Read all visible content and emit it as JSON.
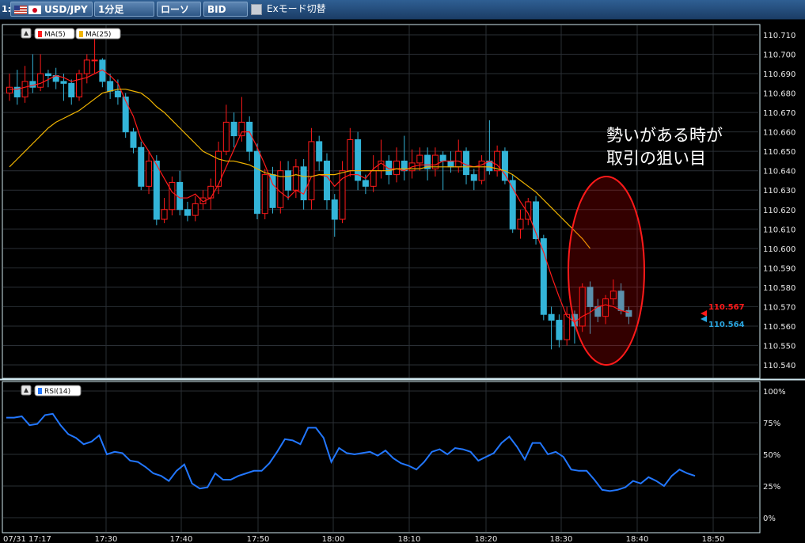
{
  "toolbar": {
    "index": "1:",
    "pair": "USD/JPY",
    "timeframe": "1分足",
    "chart_type": "ローソク",
    "price_side": "BID",
    "ex_mode": "Exモード切替"
  },
  "colors": {
    "up": "#ff1a1a",
    "down": "#33b4d8",
    "ma5": "#ff1a1a",
    "ma25": "#f0b400",
    "rsi": "#2277ff",
    "grid": "#2a2f35"
  },
  "main_legend": {
    "ma5": "MA(5)",
    "ma25": "MA(25)"
  },
  "rsi_legend": {
    "label": "RSI(14)"
  },
  "annotation": {
    "line1": "勢いがある時が",
    "line2": "取引の狙い目"
  },
  "chart_data": [
    {
      "type": "candlestick",
      "y_ticks": [
        "110.710",
        "110.700",
        "110.690",
        "110.680",
        "110.670",
        "110.660",
        "110.650",
        "110.640",
        "110.630",
        "110.620",
        "110.610",
        "110.600",
        "110.590",
        "110.580",
        "110.570",
        "110.560",
        "110.550",
        "110.540"
      ],
      "ylim": [
        110.535,
        110.715
      ],
      "x_ticks": [
        "07/31 17:17",
        "17:30",
        "17:40",
        "17:50",
        "18:00",
        "18:10",
        "18:20",
        "18:30",
        "18:40",
        "18:50"
      ],
      "price_tags": {
        "ask": "110.567",
        "bid": "110.564"
      },
      "candles": [
        [
          110.68,
          110.683,
          110.69,
          110.676
        ],
        [
          110.683,
          110.678,
          110.692,
          110.674
        ],
        [
          110.678,
          110.686,
          110.694,
          110.675
        ],
        [
          110.686,
          110.683,
          110.7,
          110.68
        ],
        [
          110.683,
          110.69,
          110.7,
          110.681
        ],
        [
          110.69,
          110.689,
          110.692,
          110.683
        ],
        [
          110.689,
          110.686,
          110.693,
          110.682
        ],
        [
          110.686,
          110.685,
          110.69,
          110.676
        ],
        [
          110.685,
          110.678,
          110.687,
          110.674
        ],
        [
          110.678,
          110.69,
          110.692,
          110.676
        ],
        [
          110.69,
          110.697,
          110.7,
          110.685
        ],
        [
          110.697,
          110.697,
          110.708,
          110.69
        ],
        [
          110.697,
          110.686,
          110.698,
          110.683
        ],
        [
          110.686,
          110.681,
          110.69,
          110.677
        ],
        [
          110.681,
          110.678,
          110.687,
          110.674
        ],
        [
          110.678,
          110.66,
          110.68,
          110.657
        ],
        [
          110.66,
          110.652,
          110.662,
          110.649
        ],
        [
          110.652,
          110.632,
          110.655,
          110.63
        ],
        [
          110.632,
          110.645,
          110.65,
          110.628
        ],
        [
          110.645,
          110.615,
          110.648,
          110.612
        ],
        [
          110.615,
          110.62,
          110.626,
          110.613
        ],
        [
          110.62,
          110.634,
          110.637,
          110.617
        ],
        [
          110.634,
          110.62,
          110.64,
          110.617
        ],
        [
          110.62,
          110.617,
          110.624,
          110.614
        ],
        [
          110.617,
          110.623,
          110.627,
          110.614
        ],
        [
          110.623,
          110.626,
          110.63,
          110.62
        ],
        [
          110.626,
          110.632,
          110.636,
          110.62
        ],
        [
          110.632,
          110.65,
          110.655,
          110.628
        ],
        [
          110.65,
          110.665,
          110.674,
          110.648
        ],
        [
          110.665,
          110.658,
          110.67,
          110.652
        ],
        [
          110.658,
          110.665,
          110.678,
          110.655
        ],
        [
          110.665,
          110.65,
          110.668,
          110.645
        ],
        [
          110.65,
          110.618,
          110.654,
          110.615
        ],
        [
          110.618,
          110.638,
          110.641,
          110.615
        ],
        [
          110.638,
          110.621,
          110.642,
          110.618
        ],
        [
          110.621,
          110.64,
          110.645,
          110.618
        ],
        [
          110.64,
          110.63,
          110.645,
          110.625
        ],
        [
          110.63,
          110.642,
          110.646,
          110.626
        ],
        [
          110.642,
          110.625,
          110.646,
          110.62
        ],
        [
          110.625,
          110.655,
          110.662,
          110.62
        ],
        [
          110.655,
          110.645,
          110.658,
          110.64
        ],
        [
          110.645,
          110.625,
          110.649,
          110.62
        ],
        [
          110.625,
          110.615,
          110.628,
          110.606
        ],
        [
          110.615,
          110.64,
          110.645,
          110.613
        ],
        [
          110.64,
          110.656,
          110.662,
          110.637
        ],
        [
          110.656,
          110.635,
          110.66,
          110.63
        ],
        [
          110.635,
          110.632,
          110.638,
          110.628
        ],
        [
          110.632,
          110.64,
          110.648,
          110.629
        ],
        [
          110.64,
          110.645,
          110.656,
          110.636
        ],
        [
          110.645,
          110.638,
          110.648,
          110.633
        ],
        [
          110.638,
          110.645,
          110.652,
          110.634
        ],
        [
          110.645,
          110.64,
          110.658,
          110.635
        ],
        [
          110.64,
          110.644,
          110.651,
          110.636
        ],
        [
          110.644,
          110.648,
          110.652,
          110.64
        ],
        [
          110.648,
          110.641,
          110.652,
          110.635
        ],
        [
          110.641,
          110.648,
          110.652,
          110.637
        ],
        [
          110.648,
          110.645,
          110.65,
          110.63
        ],
        [
          110.645,
          110.642,
          110.65,
          110.639
        ],
        [
          110.642,
          110.65,
          110.656,
          110.639
        ],
        [
          110.65,
          110.638,
          110.652,
          110.633
        ],
        [
          110.638,
          110.635,
          110.641,
          110.63
        ],
        [
          110.635,
          110.645,
          110.648,
          110.633
        ],
        [
          110.645,
          110.64,
          110.666,
          110.638
        ],
        [
          110.64,
          110.65,
          110.653,
          110.637
        ],
        [
          110.65,
          110.635,
          110.652,
          110.633
        ],
        [
          110.635,
          110.61,
          110.638,
          110.608
        ],
        [
          110.61,
          110.615,
          110.62,
          110.605
        ],
        [
          110.615,
          110.624,
          110.626,
          110.612
        ],
        [
          110.624,
          110.605,
          110.627,
          110.602
        ],
        [
          110.605,
          110.566,
          110.607,
          110.563
        ],
        [
          110.566,
          110.563,
          110.57,
          110.548
        ],
        [
          110.563,
          110.553,
          110.566,
          110.549
        ],
        [
          110.553,
          110.566,
          110.57,
          110.55
        ],
        [
          110.566,
          110.56,
          110.568,
          110.551
        ],
        [
          110.56,
          110.58,
          110.582,
          110.557
        ],
        [
          110.58,
          110.57,
          110.583,
          110.556
        ],
        [
          110.57,
          110.565,
          110.574,
          110.562
        ],
        [
          110.565,
          110.574,
          110.576,
          110.561
        ],
        [
          110.574,
          110.578,
          110.584,
          110.571
        ],
        [
          110.578,
          110.568,
          110.582,
          110.566
        ],
        [
          110.568,
          110.565,
          110.57,
          110.561
        ]
      ],
      "ma5": [
        110.682,
        110.682,
        110.683,
        110.684,
        110.685,
        110.687,
        110.689,
        110.688,
        110.686,
        110.687,
        110.688,
        110.69,
        110.692,
        110.689,
        110.685,
        110.676,
        110.668,
        110.656,
        110.65,
        110.643,
        110.636,
        110.629,
        110.626,
        110.626,
        110.628,
        110.624,
        110.626,
        110.633,
        110.642,
        110.651,
        110.66,
        110.66,
        110.652,
        110.643,
        110.633,
        110.629,
        110.626,
        110.63,
        110.628,
        110.637,
        110.638,
        110.637,
        110.632,
        110.636,
        110.638,
        110.638,
        110.636,
        110.641,
        110.644,
        110.641,
        110.641,
        110.64,
        110.642,
        110.643,
        110.643,
        110.643,
        110.645,
        110.645,
        110.645,
        110.643,
        110.642,
        110.643,
        110.645,
        110.643,
        110.638,
        110.631,
        110.624,
        110.618,
        110.608,
        110.598,
        110.586,
        110.575,
        110.565,
        110.562,
        110.565,
        110.567,
        110.57,
        110.571,
        110.57,
        110.568,
        110.567
      ],
      "ma25": [
        110.642,
        110.646,
        110.65,
        110.654,
        110.658,
        110.662,
        110.665,
        110.667,
        110.669,
        110.671,
        110.674,
        110.677,
        110.68,
        110.681,
        110.682,
        110.682,
        110.681,
        110.68,
        110.677,
        110.673,
        110.67,
        110.666,
        110.662,
        110.658,
        110.654,
        110.65,
        110.648,
        110.646,
        110.645,
        110.645,
        110.644,
        110.643,
        110.641,
        110.639,
        110.638,
        110.637,
        110.637,
        110.638,
        110.637,
        110.637,
        110.638,
        110.638,
        110.638,
        110.639,
        110.64,
        110.64,
        110.64,
        110.64,
        110.64,
        110.64,
        110.641,
        110.641,
        110.641,
        110.641,
        110.642,
        110.642,
        110.642,
        110.642,
        110.642,
        110.642,
        110.642,
        110.642,
        110.642,
        110.641,
        110.64,
        110.638,
        110.635,
        110.632,
        110.629,
        110.625,
        110.621,
        110.617,
        110.613,
        110.609,
        110.605,
        110.6
      ]
    },
    {
      "type": "line",
      "name": "RSI(14)",
      "y_ticks": [
        "100%",
        "75%",
        "50%",
        "25%",
        "0%"
      ],
      "ylim": [
        0,
        100
      ],
      "values": [
        79,
        79,
        80,
        73,
        74,
        81,
        82,
        73,
        66,
        63,
        58,
        60,
        65,
        50,
        52,
        51,
        45,
        44,
        40,
        35,
        33,
        29,
        37,
        42,
        27,
        23,
        24,
        35,
        30,
        30,
        33,
        35,
        37,
        37,
        43,
        52,
        62,
        61,
        58,
        71,
        71,
        63,
        44,
        55,
        51,
        50,
        51,
        52,
        49,
        53,
        47,
        43,
        41,
        38,
        44,
        52,
        54,
        50,
        55,
        54,
        52,
        45,
        48,
        51,
        59,
        64,
        56,
        46,
        59,
        59,
        50,
        52,
        48,
        38,
        37,
        37,
        30,
        22,
        21,
        22,
        24,
        29,
        27,
        32,
        29,
        25,
        33,
        38,
        35,
        33
      ]
    }
  ]
}
